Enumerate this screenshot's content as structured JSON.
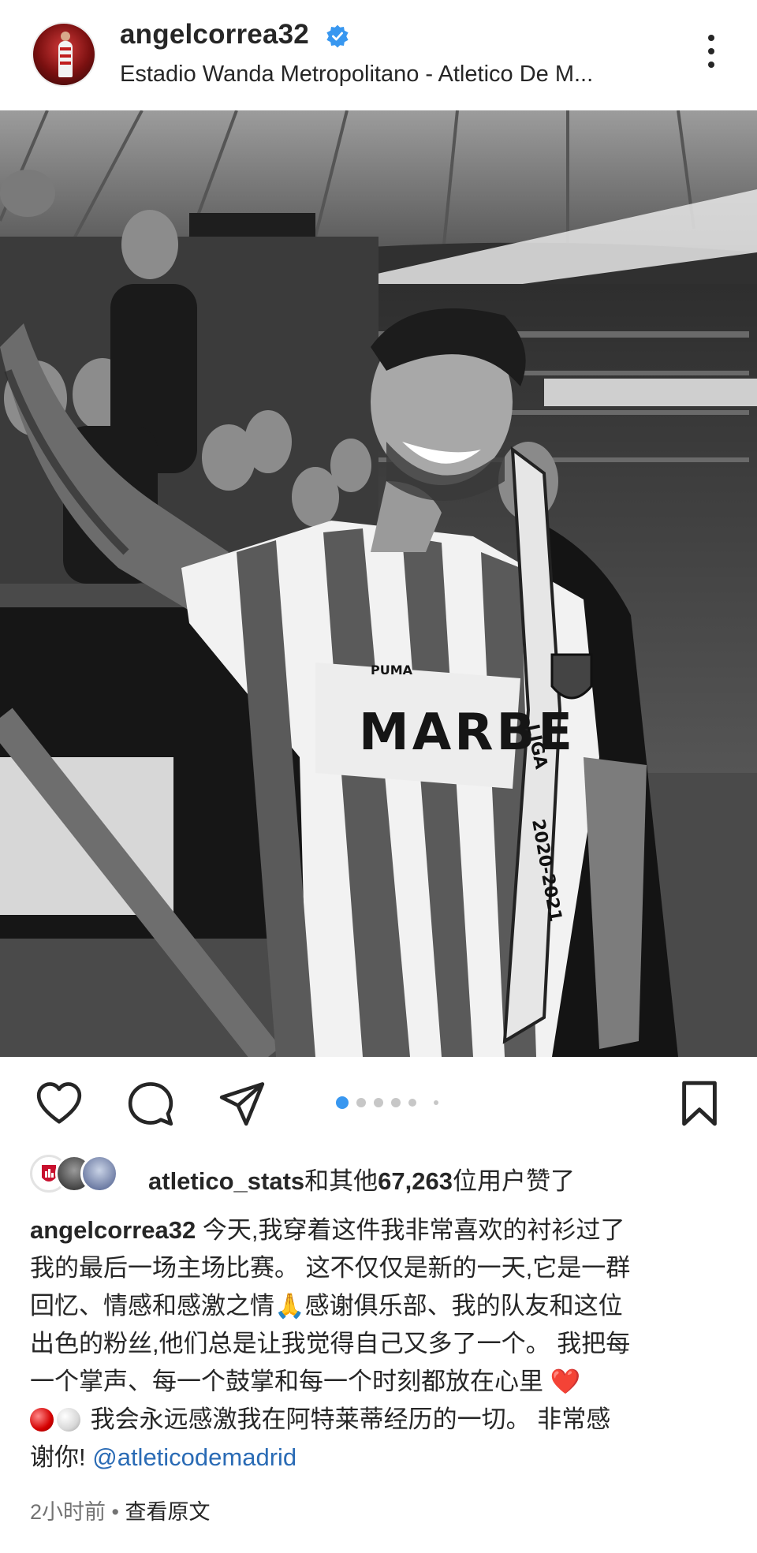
{
  "post": {
    "username": "angelcorrea32",
    "location": "Estadio Wanda Metropolitano - Atletico De M...",
    "verified": true,
    "more_icon": "more-vertical-icon"
  },
  "photo": {
    "jersey_sponsor": "MARBE",
    "brand": "PUMA",
    "medal_ribbon_text": "2020-2021",
    "medal_ribbon_text2": "LIGA"
  },
  "actions": {
    "like_icon": "heart-icon",
    "comment_icon": "comment-icon",
    "share_icon": "send-icon",
    "save_icon": "bookmark-icon",
    "carousel_pages": 6,
    "carousel_active": 0
  },
  "likes": {
    "liked_by": "atletico_stats",
    "text_suffix": "和其他",
    "count": "67,263",
    "text_end": "位用户赞了"
  },
  "caption": {
    "username": "angelcorrea32",
    "line1": " 今天,我穿着这件我非常喜欢的衬衫过了",
    "line2": "我的最后一场主场比赛。 这不仅仅是新的一天,它是一群",
    "line3": "回忆、情感和感激之情🙏感谢俱乐部、我的队友和这位",
    "line4": "出色的粉丝,他们总是让我觉得自己又多了一个。 我把每",
    "line5": "一个掌声、每一个鼓掌和每一个时刻都放在心里 ❤️",
    "line6": " 我会永远感激我在阿特莱蒂经历的一切。 非常感",
    "line7": "谢你! ",
    "mention": "@atleticodemadrid"
  },
  "meta": {
    "time": "2小时前",
    "separator": " • ",
    "see_original": "查看原文"
  },
  "colors": {
    "text": "#262626",
    "secondary": "#737373",
    "link": "#2a6bb5",
    "verified": "#3897f0",
    "carousel_active": "#3897f0",
    "carousel_inactive": "#c7c7c7"
  }
}
